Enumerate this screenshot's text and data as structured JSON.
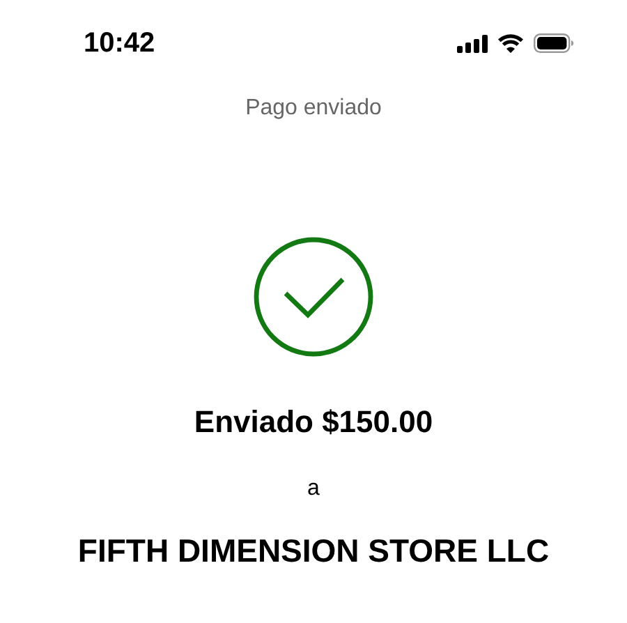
{
  "status_bar": {
    "time": "10:42"
  },
  "header": {
    "title": "Pago enviado"
  },
  "confirmation": {
    "amount_line": "Enviado $150.00",
    "connector": "a",
    "recipient": "FIFTH DIMENSION STORE LLC"
  }
}
